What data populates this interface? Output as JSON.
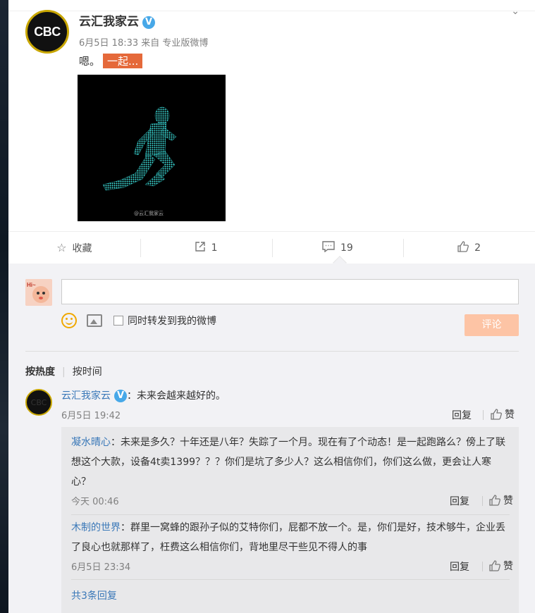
{
  "post": {
    "author": "云汇我家云",
    "verified_mark": "V",
    "avatar_text": "CBC",
    "meta": "6月5日 18:33 来自 专业版微博",
    "text": "嗯。",
    "tag": "一起...",
    "image_watermark": "@云汇我家云"
  },
  "actions": {
    "favorite_label": "收藏",
    "forward_count": "1",
    "comment_count": "19",
    "like_count": "2"
  },
  "composer": {
    "forward_checkbox_label": "同时转发到我的微博",
    "submit_label": "评论",
    "avatar_text": "Hi~"
  },
  "sort": {
    "by_hot": "按热度",
    "by_time": "按时间"
  },
  "comments": [
    {
      "author": "云汇我家云",
      "avatar_text": "CBC",
      "text": "：未来会越来越好的。",
      "time": "6月5日 19:42",
      "reply_label": "回复",
      "like_label": "赞",
      "replies": [
        {
          "author": "凝水晴心",
          "text": "：未来是多久？十年还是八年？失踪了一个月。现在有了个动态！是一起跑路么？傍上了联想这个大款，设备4t卖1399？？？你们是坑了多少人？这么相信你们，你们这么做，更会让人寒心？",
          "time": "今天 00:46",
          "reply_label": "回复",
          "like_label": "赞"
        },
        {
          "author": "木制的世界",
          "text": "：群里一窝蜂的跟孙子似的艾特你们，屁都不放一个。是，你们是好，技术够牛，企业丢了良心也就那样了，枉费这么相信你们，背地里尽干些见不得人的事",
          "time": "6月5日 23:34",
          "reply_label": "回复",
          "like_label": "赞"
        }
      ],
      "more_replies": "共3条回复"
    }
  ]
}
